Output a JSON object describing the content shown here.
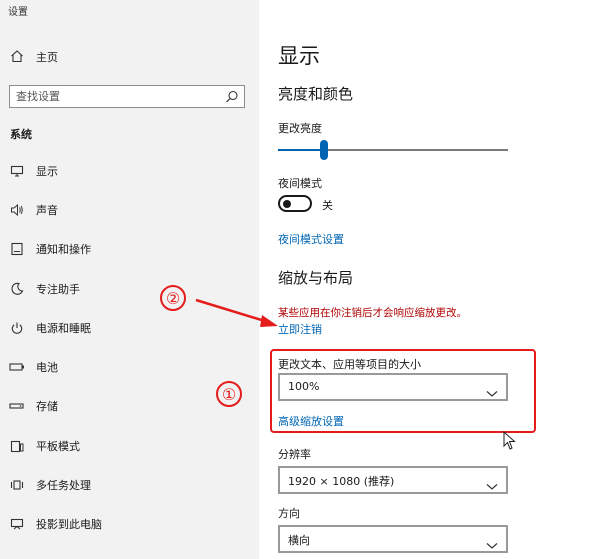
{
  "window": {
    "title": "设置"
  },
  "sidebar": {
    "home_label": "主页",
    "search_placeholder": "查找设置",
    "section_label": "系统",
    "items": [
      {
        "label": "显示",
        "icon": "monitor-icon"
      },
      {
        "label": "声音",
        "icon": "speaker-icon"
      },
      {
        "label": "通知和操作",
        "icon": "notification-icon"
      },
      {
        "label": "专注助手",
        "icon": "moon-icon"
      },
      {
        "label": "电源和睡眠",
        "icon": "power-icon"
      },
      {
        "label": "电池",
        "icon": "battery-icon"
      },
      {
        "label": "存储",
        "icon": "storage-icon"
      },
      {
        "label": "平板模式",
        "icon": "tablet-icon"
      },
      {
        "label": "多任务处理",
        "icon": "multitask-icon"
      },
      {
        "label": "投影到此电脑",
        "icon": "project-icon"
      }
    ]
  },
  "main": {
    "page_title": "显示",
    "brightness_section": {
      "heading": "亮度和颜色",
      "brightness_label": "更改亮度",
      "brightness_value": 0.2,
      "night_light_label": "夜间模式",
      "night_light_state": "关",
      "night_light_settings_link": "夜间模式设置"
    },
    "scale_section": {
      "heading": "缩放与布局",
      "warning_text": "某些应用在你注销后才会响应缩放更改。",
      "sign_out_link": "立即注销",
      "text_size_label": "更改文本、应用等项目的大小",
      "text_size_value": "100%",
      "advanced_scaling_link": "高级缩放设置",
      "resolution_label": "分辨率",
      "resolution_value": "1920 × 1080 (推荐)",
      "orientation_label": "方向",
      "orientation_value": "横向"
    }
  },
  "annotations": {
    "marker_1": "①",
    "marker_2": "②",
    "highlight_color": "#e51c1c"
  },
  "colors": {
    "accent": "#0063b1",
    "link": "#0066b4",
    "warning": "#b00000",
    "sidebar_bg": "#f2f2f2"
  }
}
